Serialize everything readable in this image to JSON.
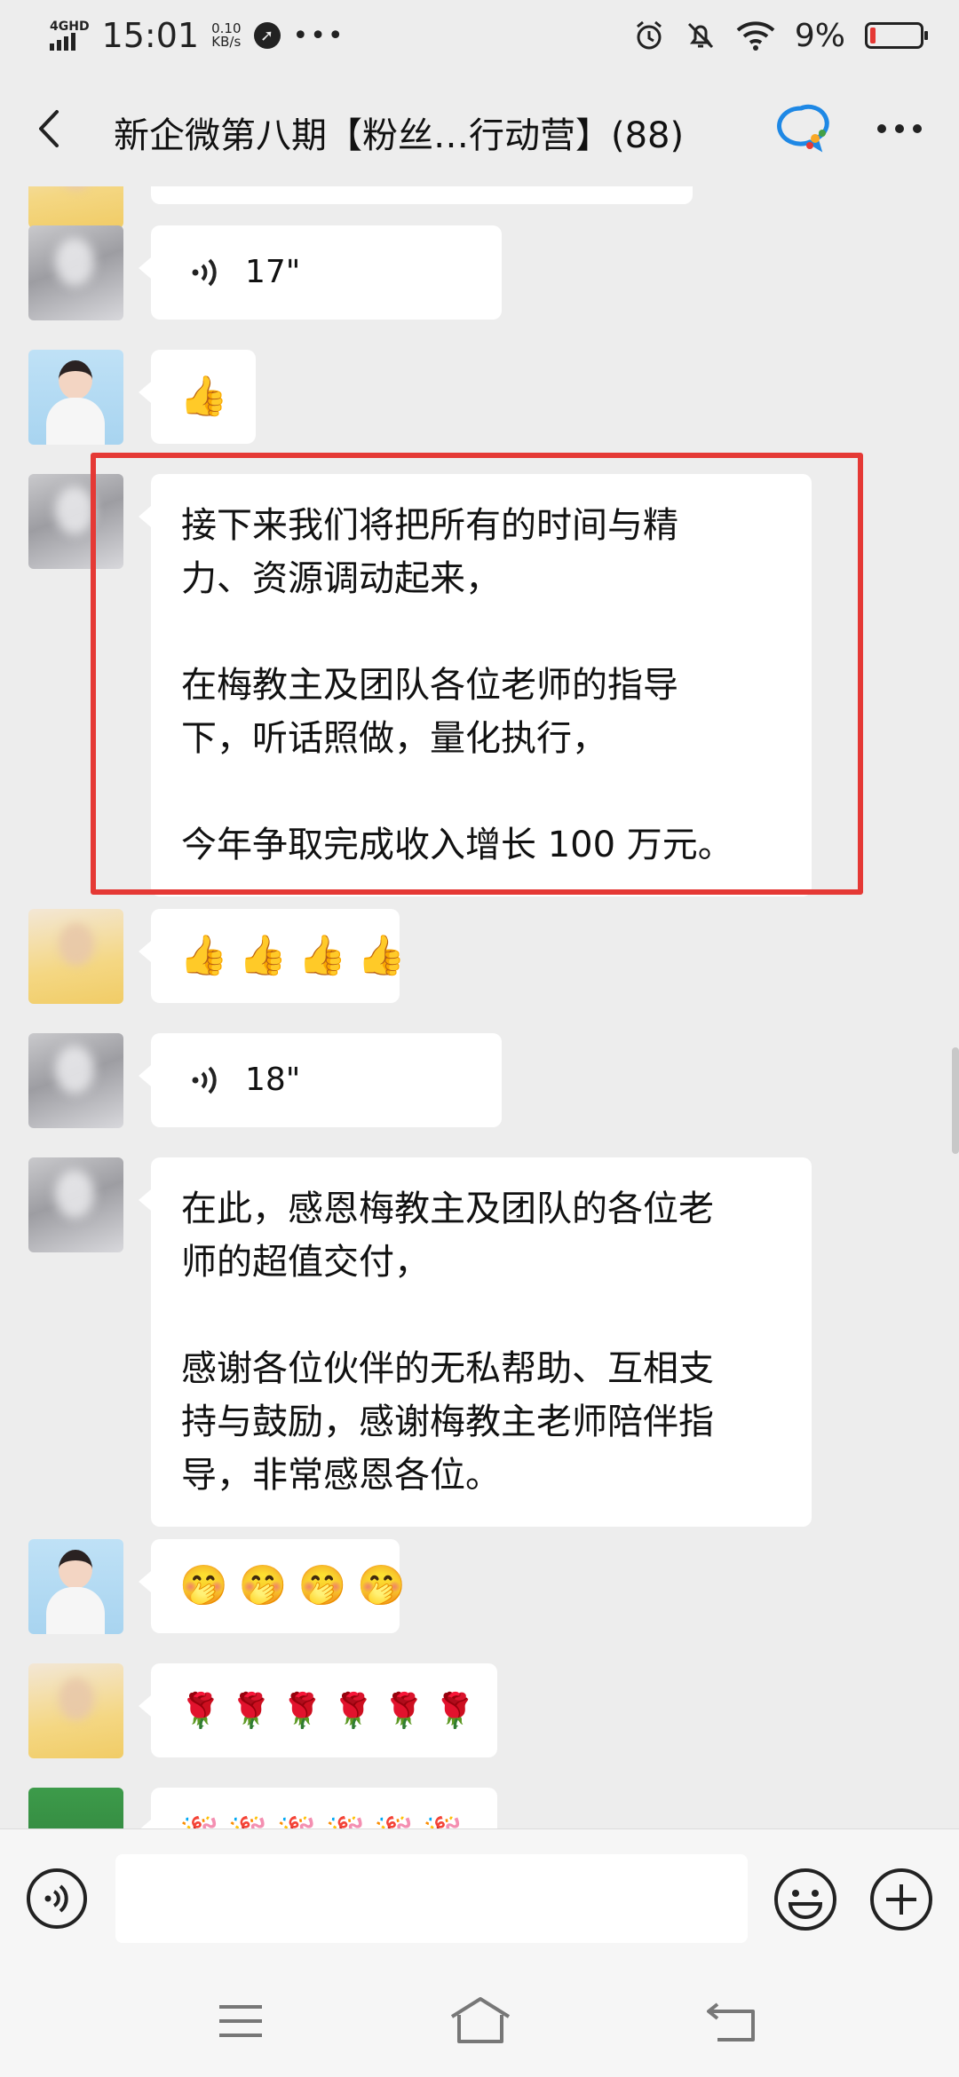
{
  "status_bar": {
    "network": "4GHD",
    "time": "15:01",
    "speed_value": "0.10",
    "speed_unit": "KB/s",
    "battery": "9%",
    "battery_level": 0.09
  },
  "header": {
    "title": "新企微第八期【粉丝…行动营】(88)"
  },
  "messages": [
    {
      "type": "voice",
      "duration": "17\""
    },
    {
      "type": "emoji",
      "items": [
        "👍"
      ]
    },
    {
      "type": "text",
      "highlighted": true,
      "lines": [
        "接下来我们将把所有的时间与精",
        "力、资源调动起来，",
        "",
        "在梅教主及团队各位老师的指导",
        "下，听话照做，量化执行，",
        "",
        "今年争取完成收入增长 100 万元。"
      ]
    },
    {
      "type": "emoji",
      "items": [
        "👍",
        "👍",
        "👍",
        "👍"
      ]
    },
    {
      "type": "voice",
      "duration": "18\""
    },
    {
      "type": "text",
      "lines": [
        "在此，感恩梅教主及团队的各位老",
        "师的超值交付，",
        "",
        "感谢各位伙伴的无私帮助、互相支",
        "持与鼓励，感谢梅教主老师陪伴指",
        "导，非常感恩各位。"
      ]
    },
    {
      "type": "emoji",
      "items": [
        "🤭",
        "🤭",
        "🤭",
        "🤭"
      ]
    },
    {
      "type": "emoji",
      "items": [
        "🌹",
        "🌹",
        "🌹",
        "🌹",
        "🌹",
        "🌹"
      ]
    },
    {
      "type": "emoji",
      "items": [
        "🎉",
        "🎉",
        "🎉",
        "🎉",
        "🎉",
        "🎉"
      ]
    }
  ],
  "input_bar": {
    "placeholder": ""
  }
}
